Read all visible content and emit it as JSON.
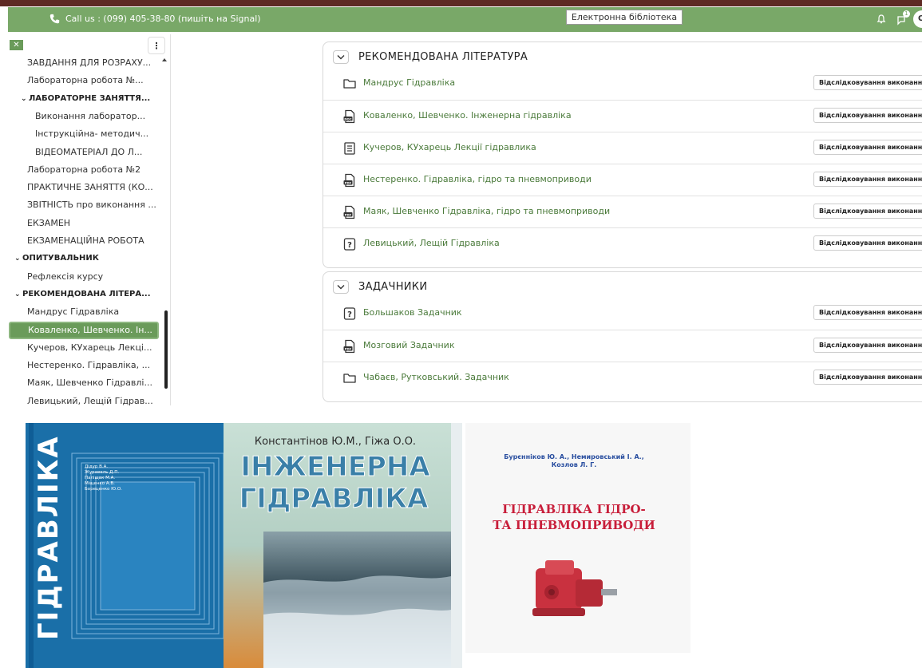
{
  "header": {
    "phone": "Call us : (099) 405-38-80 (пишіть на Signal)",
    "library_button": "Електронна бібліотека",
    "notification_count": "1",
    "user_label": "On"
  },
  "sidebar": {
    "items": [
      {
        "label": "ЗАВДАННЯ ДЛЯ РОЗРАХУ...",
        "level": 1,
        "bold": false
      },
      {
        "label": "Лабораторна робота №...",
        "level": 1,
        "bold": false
      },
      {
        "label": "ЛАБОРАТОРНЕ ЗАНЯТТЯ...",
        "level": 1,
        "bold": true,
        "chevron": true
      },
      {
        "label": "Виконання лаборатор...",
        "level": 2,
        "bold": false
      },
      {
        "label": "Інструкційна- методич...",
        "level": 2,
        "bold": false
      },
      {
        "label": "ВІДЕОМАТЕРІАЛ ДО Л...",
        "level": 2,
        "bold": false
      },
      {
        "label": "Лабораторна робота №2",
        "level": 1,
        "bold": false
      },
      {
        "label": "ПРАКТИЧНЕ ЗАНЯТТЯ (КО...",
        "level": 1,
        "bold": false
      },
      {
        "label": "ЗВІТНІСТЬ про виконання ...",
        "level": 1,
        "bold": false
      },
      {
        "label": "ЕКЗАМЕН",
        "level": 1,
        "bold": false
      },
      {
        "label": "ЕКЗАМЕНАЦІЙНА РОБОТА",
        "level": 1,
        "bold": false
      },
      {
        "label": "ОПИТУВАЛЬНИК",
        "level": 0,
        "bold": true,
        "chevron": true
      },
      {
        "label": "Рефлексія курсу",
        "level": 1,
        "bold": false
      },
      {
        "label": "РЕКОМЕНДОВАНА ЛІТЕРА...",
        "level": 0,
        "bold": true,
        "chevron": true
      },
      {
        "label": "Мандрус Гідравліка",
        "level": 1,
        "bold": false
      },
      {
        "label": "Коваленко, Шевченко. Ін...",
        "level": 1,
        "bold": false,
        "active": true
      },
      {
        "label": "Кучеров, КУхарець Лекці...",
        "level": 1,
        "bold": false
      },
      {
        "label": "Нестеренко. Гідравліка, ...",
        "level": 1,
        "bold": false
      },
      {
        "label": "Маяк, Шевченко Гідравлі...",
        "level": 1,
        "bold": false
      },
      {
        "label": "Левицький, Лещій Гідрав...",
        "level": 1,
        "bold": false
      }
    ]
  },
  "sections": [
    {
      "title": "РЕКОМЕНДОВАНА ЛІТЕРАТУРА",
      "activities": [
        {
          "name": "Мандрус Гідравліка",
          "icon": "folder-icon"
        },
        {
          "name": "Коваленко, Шевченко. Інженерна гідравліка",
          "icon": "doc-file-icon"
        },
        {
          "name": "Кучеров, КУхарець Лекції гідравлика",
          "icon": "page-icon"
        },
        {
          "name": "Нестеренко. Гідравліка, гідро та пневмоприводи",
          "icon": "pdf-file-icon"
        },
        {
          "name": "Маяк, Шевченко Гідравліка, гідро та пневмоприводи",
          "icon": "pdf-file-icon"
        },
        {
          "name": "Левицький, Лещій Гідравліка",
          "icon": "quiz-icon"
        }
      ]
    },
    {
      "title": "ЗАДАЧНИКИ",
      "activities": [
        {
          "name": "Большаков Задачник",
          "icon": "quiz-icon"
        },
        {
          "name": "Мозговий Задачник",
          "icon": "pdf-file-icon"
        },
        {
          "name": "Чабаєв, Рутковський. Задачник",
          "icon": "folder-icon"
        }
      ]
    }
  ],
  "tracking_label": "Відслідковування виконання",
  "covers": {
    "cover1": {
      "title": "ГІДРАВЛІКА",
      "authors": [
        "Дідур В.А.",
        "Журавель Д.П.",
        "Паліщак М.А.",
        "Міщенко А.В.",
        "Бореценко Ю.О."
      ]
    },
    "cover2": {
      "authors": "Константінов Ю.М., Гіжа О.О.",
      "title_line1": "ІНЖЕНЕРНА",
      "title_line2": "ГІДРАВЛІКА"
    },
    "cover3": {
      "authors_line1": "Бурєнніков Ю. А., Немировський І. А.,",
      "authors_line2": "Козлов Л. Г.",
      "title_line1": "ГІДРАВЛІКА ГІДРО-",
      "title_line2": "ТА ПНЕВМОПРИВОДИ"
    }
  },
  "colors": {
    "accent": "#79a868",
    "active": "#6a9b5a",
    "link": "#4a7a3a",
    "top_strip": "#5e2a24"
  }
}
